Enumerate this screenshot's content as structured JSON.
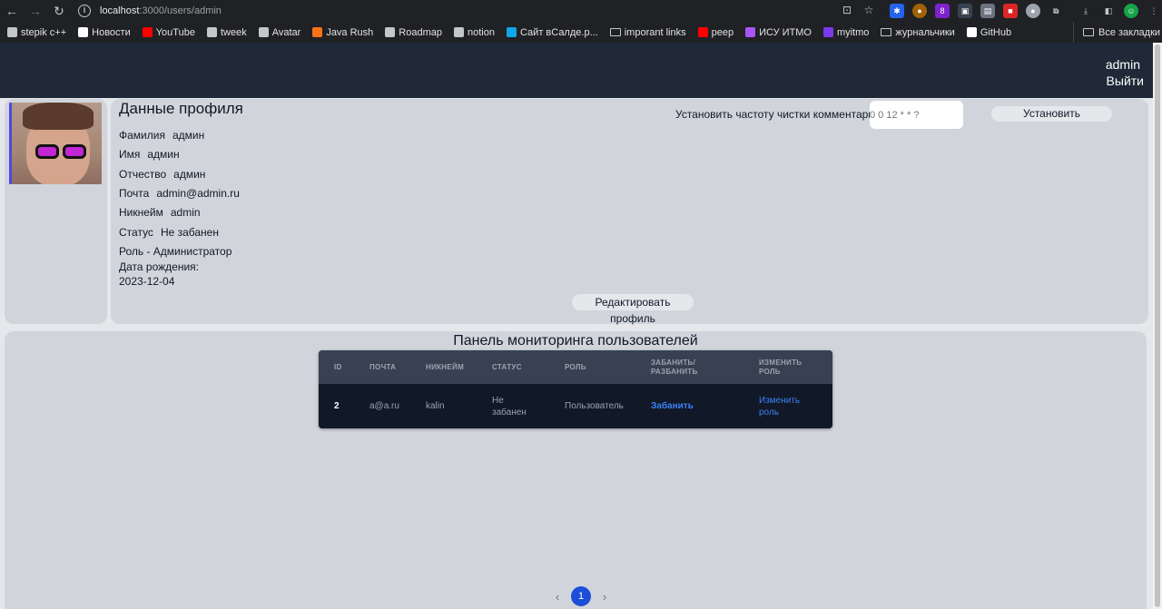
{
  "browser": {
    "url_host": "localhost",
    "url_path": ":3000/users/admin",
    "bookmarks": [
      {
        "label": "stepik c++",
        "color": "#c4c7c5"
      },
      {
        "label": "Новости",
        "color": "#ffffff"
      },
      {
        "label": "YouTube",
        "color": "#ff0000"
      },
      {
        "label": "tweek",
        "color": "#c4c7c5"
      },
      {
        "label": "Avatar",
        "color": "#c4c7c5"
      },
      {
        "label": "Java Rush",
        "color": "#f97316"
      },
      {
        "label": "Roadmap",
        "color": "#c4c7c5"
      },
      {
        "label": "notion",
        "color": "#c4c7c5"
      },
      {
        "label": "Сайт вСалде.р...",
        "color": "#0ea5e9"
      },
      {
        "label": "imporant links",
        "color": "folder"
      },
      {
        "label": "peep",
        "color": "#ff0000"
      },
      {
        "label": "ИСУ ИТМО",
        "color": "#a855f7"
      },
      {
        "label": "myitmo",
        "color": "#7c3aed"
      },
      {
        "label": "журнальчики",
        "color": "folder"
      },
      {
        "label": "GitHub",
        "color": "#ffffff"
      }
    ],
    "more": "»",
    "all_bookmarks": "Все закладки"
  },
  "header": {
    "username": "admin",
    "logout": "Выйти"
  },
  "profile": {
    "title": "Данные профиля",
    "fields": [
      {
        "label": "Фамилия",
        "value": "админ"
      },
      {
        "label": "Имя",
        "value": "админ"
      },
      {
        "label": "Отчество",
        "value": "админ"
      },
      {
        "label": "Почта",
        "value": "admin@admin.ru"
      },
      {
        "label": "Никнейм",
        "value": "admin"
      },
      {
        "label": "Статус",
        "value": "Не забанен"
      }
    ],
    "role": "Роль - Администратор",
    "birth_label": "Дата рождения:",
    "birth_value": "2023-12-04",
    "edit_button": "Редактировать профиль"
  },
  "cron": {
    "label": "Установить частоту чистки комментариев",
    "placeholder": "0 0 12 * * ?",
    "button": "Установить"
  },
  "monitor": {
    "title": "Панель мониторинга пользователей",
    "columns": [
      "ID",
      "ПОЧТА",
      "НИКНЕЙМ",
      "СТАТУС",
      "РОЛЬ",
      "ЗАБАНИТЬ/ РАЗБАНИТЬ",
      "ИЗМЕНИТЬ РОЛЬ"
    ],
    "rows": [
      {
        "id": "2",
        "email": "a@a.ru",
        "nickname": "kalin",
        "status": "Не забанен",
        "role": "Пользователь",
        "ban_action": "Забанить",
        "role_action": "Изменить роль"
      }
    ]
  },
  "pagination": {
    "prev": "‹",
    "current": "1",
    "next": "›"
  },
  "colors": {
    "header_bg": "#1f2937",
    "card_bg": "#d1d5db",
    "link": "#3b82f6",
    "page_active": "#1d4ed8"
  }
}
